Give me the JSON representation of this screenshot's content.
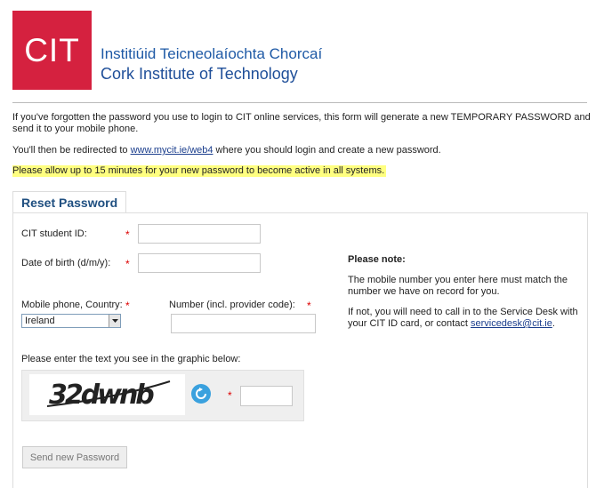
{
  "logo": {
    "mark": "CIT",
    "name_irish": "Institiúid Teicneolaíochta Chorcaí",
    "name_english": "Cork Institute of Technology"
  },
  "intro": {
    "p1": "If you've forgotten the password you use to login to CIT online services, this form will generate a new TEMPORARY PASSWORD and send it to your mobile phone.",
    "p2_before": "You'll then be redirected to ",
    "p2_link": "www.mycit.ie/web4",
    "p2_after": " where you should login and create a new password.",
    "p3": "Please allow up to 15 minutes for your new password to become active in all systems."
  },
  "form": {
    "tab_label": "Reset Password",
    "student_id_label": "CIT student ID:",
    "dob_label": "Date of birth (d/m/y):",
    "country_label": "Mobile phone, Country:",
    "country_value": "Ireland",
    "number_label": "Number (incl. provider code):",
    "required_mark": "*",
    "captcha_label": "Please enter the text you see in the graphic below:",
    "captcha_text": "32dwnb",
    "submit_label": "Send new Password"
  },
  "note": {
    "title": "Please note:",
    "line1": "The mobile number you enter here must match the number we have on record for you.",
    "line2_before": "If not, you will need to call in to the Service Desk with your CIT ID card, or contact ",
    "line2_link": "servicedesk@cit.ie",
    "line2_after": "."
  },
  "colors": {
    "brand_red": "#d5213f",
    "brand_blue": "#1f5aa6",
    "highlight": "#ffff80",
    "refresh_blue": "#3aa1de"
  }
}
